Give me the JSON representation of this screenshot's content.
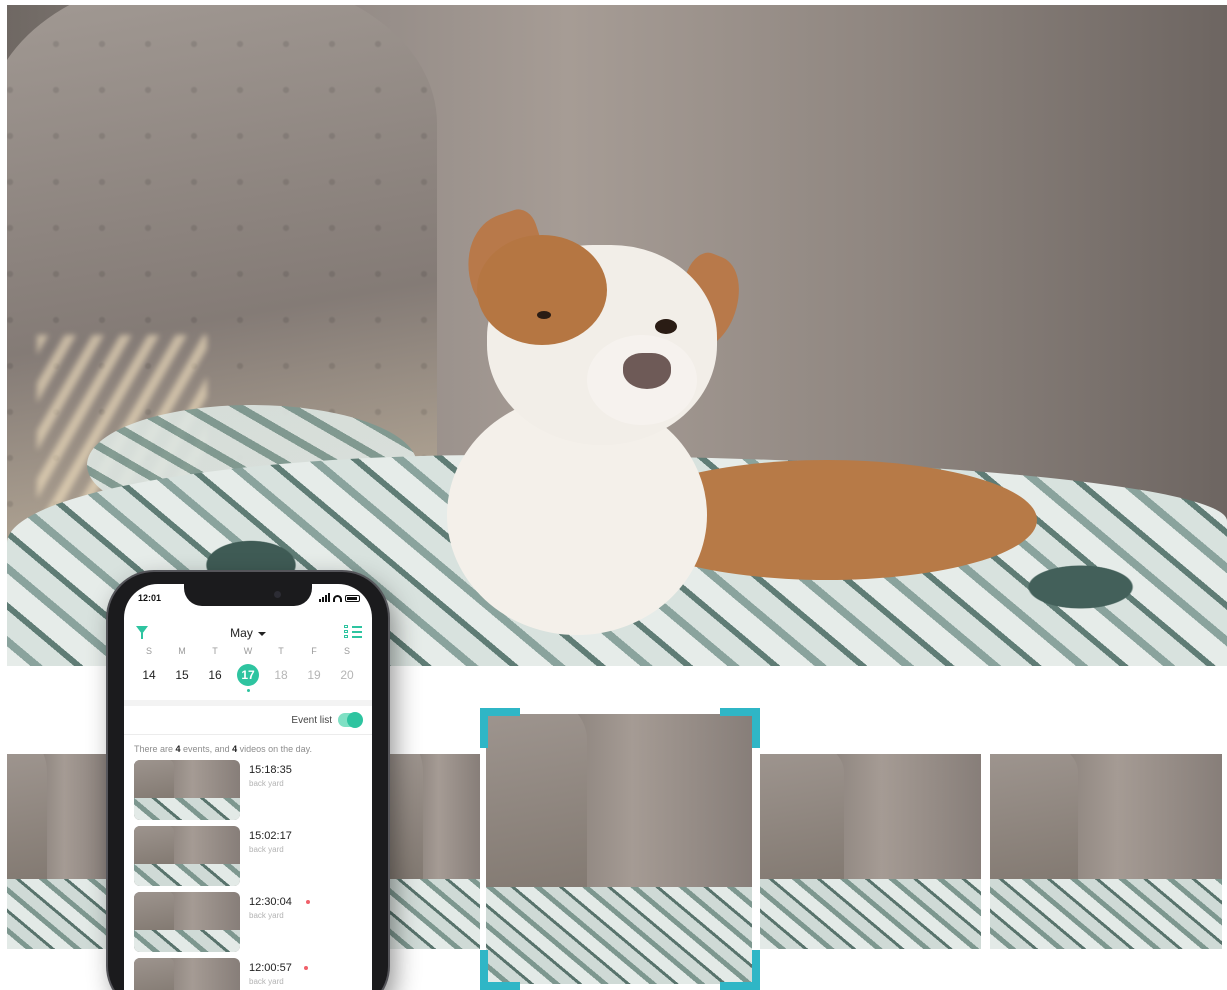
{
  "phone": {
    "status_time": "12:01",
    "month": "May",
    "weekdays": [
      "S",
      "M",
      "T",
      "W",
      "T",
      "F",
      "S"
    ],
    "dates": [
      {
        "day": "14",
        "state": "past"
      },
      {
        "day": "15",
        "state": "past"
      },
      {
        "day": "16",
        "state": "past"
      },
      {
        "day": "17",
        "state": "selected"
      },
      {
        "day": "18",
        "state": "future"
      },
      {
        "day": "19",
        "state": "future"
      },
      {
        "day": "20",
        "state": "future"
      }
    ],
    "event_list_label": "Event list",
    "event_list_enabled": true,
    "summary": {
      "prefix": "There are ",
      "events_count": "4",
      "middle": " events, and ",
      "videos_count": "4",
      "suffix": " videos on the day."
    },
    "events": [
      {
        "time": "15:18:35",
        "location": "back yard",
        "flagged": false
      },
      {
        "time": "15:02:17",
        "location": "back yard",
        "flagged": false
      },
      {
        "time": "12:30:04",
        "location": "back yard",
        "flagged": true
      },
      {
        "time": "12:00:57",
        "location": "back yard",
        "flagged": true
      }
    ]
  },
  "icons": {
    "filter": "funnel-filter-icon",
    "list_view": "checklist-icon",
    "signal": "cellular-signal-icon",
    "wifi": "wifi-icon",
    "battery": "battery-icon"
  },
  "colors": {
    "accent": "#2ec4a0",
    "selection_frame": "#2fb6c6",
    "flag_dot": "#f0606a"
  }
}
